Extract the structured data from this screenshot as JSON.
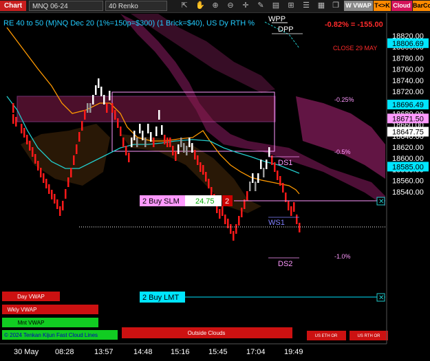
{
  "toolbar": {
    "chart_tab": "Chart",
    "instrument": "MNQ 06-24",
    "bar_type": "40 Renko",
    "vwap_button": "W VWAP",
    "tk_button": "T<>K",
    "cloud_button": "Cloud",
    "barco_button": "BarCo",
    "icons": [
      "pointer-icon",
      "hand-icon",
      "zoom-icon",
      "zoom-out-icon",
      "crosshair-icon",
      "pencil-icon",
      "bars-icon",
      "grid-icon",
      "list-icon",
      "layout-icon",
      "windows-icon"
    ]
  },
  "chart": {
    "header": "RE 40 to 50 (M)NQ Dec 20 (1%=150p=$300) (1 Brick=$40), US Dy RTH %",
    "change": "-0.82% = -155.00",
    "close_label": "CLOSE 29 MAY",
    "wpp": "WPP",
    "dpp": "DPP",
    "pct_labels": [
      "-0.25%",
      "-0.5%",
      "-1.0%"
    ],
    "ds1": "DS1",
    "ds2": "DS2",
    "ws1": "WS1",
    "legend_text": "© 2024 Tenkan Kijun Fast Cloud Lines"
  },
  "orders": {
    "buy_slm_label": "2 Buy SLM",
    "buy_slm_offset": "24.75",
    "buy_slm_qty": "2",
    "buy_lmt_label": "2 Buy LMT",
    "buy_slm_price": 18671.5,
    "buy_lmt_price": 18585.0
  },
  "buttons": {
    "day_vwap": "Day VWAP",
    "wkly_vwap": "Wkly VWAP",
    "mnt_vwap": "Mnt VWAP",
    "outside_clouds": "Outside Clouds",
    "us_eth_or": "US ETH OR",
    "us_rth_or": "US RTH OR"
  },
  "price_axis": {
    "ticks": [
      "18820.00",
      "18800.00",
      "18780.00",
      "18760.00",
      "18740.00",
      "18720.00",
      "18700.00",
      "18680.00",
      "18660.00",
      "18640.00",
      "18620.00",
      "18600.00",
      "18580.00",
      "18560.00",
      "18540.00"
    ],
    "markers": [
      {
        "text": "18806.69",
        "bg": "#00e5ff",
        "fg": "#000000"
      },
      {
        "text": "18696.49",
        "bg": "#00e5ff",
        "fg": "#000000"
      },
      {
        "text": "18671.50",
        "bg": "#ff99ff",
        "fg": "#000000"
      },
      {
        "text": "18647.75",
        "bg": "#ffffff",
        "fg": "#000000"
      },
      {
        "text": "18585.00",
        "bg": "#00e5ff",
        "fg": "#000000"
      }
    ]
  },
  "time_axis": [
    "30 May",
    "08:28",
    "13:57",
    "14:48",
    "15:16",
    "15:45",
    "17:04",
    "19:49"
  ],
  "colors": {
    "bull": "#ffffff",
    "bear": "#ff1a1a",
    "neutral": "#999999",
    "tenkan": "#ff9900",
    "kijun": "#22cccc",
    "cloud": "#8a1d5a",
    "buy_slm": "#ff99ff",
    "buy_lmt": "#00e5ff"
  }
}
